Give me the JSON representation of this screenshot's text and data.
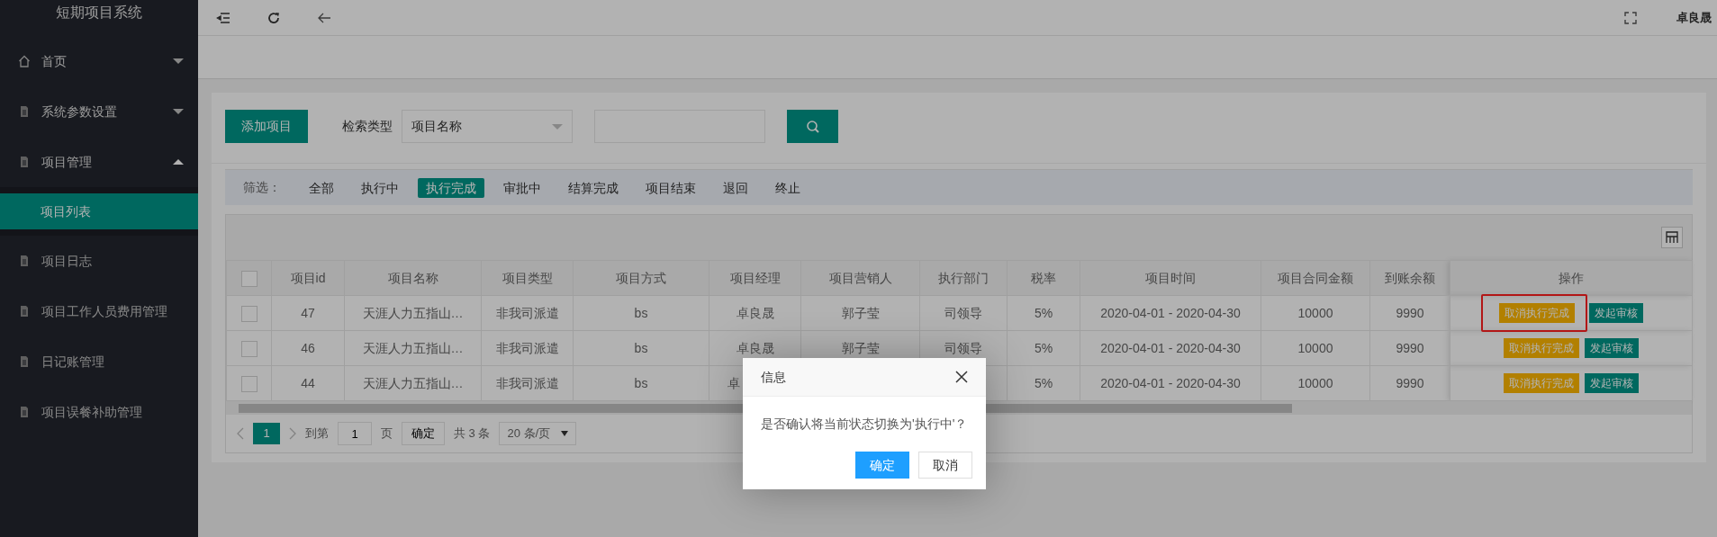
{
  "sidebar": {
    "title": "短期项目系统",
    "items": [
      {
        "label": "首页",
        "kind": "group",
        "expanded": false,
        "selected": false
      },
      {
        "label": "系统参数设置",
        "kind": "group",
        "expanded": false,
        "selected": false
      },
      {
        "label": "项目管理",
        "kind": "group",
        "expanded": true,
        "selected": false,
        "children": [
          {
            "label": "项目列表",
            "selected": true
          }
        ]
      },
      {
        "label": "项目日志",
        "kind": "link",
        "selected": false
      },
      {
        "label": "项目工作人员费用管理",
        "kind": "link",
        "selected": false
      },
      {
        "label": "日记账管理",
        "kind": "link",
        "selected": false
      },
      {
        "label": "项目误餐补助管理",
        "kind": "link",
        "selected": false
      }
    ]
  },
  "header": {
    "user": "卓良晟"
  },
  "toolbar": {
    "add_button": "添加项目",
    "search_type_label": "检索类型",
    "search_type": "项目名称"
  },
  "filter": {
    "label": "筛选：",
    "options": [
      {
        "label": "全部",
        "selected": false
      },
      {
        "label": "执行中",
        "selected": false
      },
      {
        "label": "执行完成",
        "selected": true
      },
      {
        "label": "审批中",
        "selected": false
      },
      {
        "label": "结算完成",
        "selected": false
      },
      {
        "label": "项目结束",
        "selected": false
      },
      {
        "label": "退回",
        "selected": false
      },
      {
        "label": "终止",
        "selected": false
      }
    ]
  },
  "table": {
    "all_checked": false,
    "columns": [
      "项目id",
      "项目名称",
      "项目类型",
      "项目方式",
      "项目经理",
      "项目营销人",
      "执行部门",
      "税率",
      "项目时间",
      "项目合同金额",
      "到账余额",
      "操作"
    ],
    "rows": [
      {
        "checked": false,
        "cells": [
          "47",
          "天涯人力五指山…",
          "非我司派遣",
          "bs",
          "卓良晟",
          "郭子莹",
          "司领导",
          "5%",
          "2020-04-01 - 2020-04-30",
          "10000",
          "9990"
        ],
        "actions": [
          {
            "label": "取消执行完成",
            "kind": "warning",
            "highlighted": true
          },
          {
            "label": "发起审核",
            "kind": "primary",
            "highlighted": false
          }
        ]
      },
      {
        "checked": false,
        "cells": [
          "46",
          "天涯人力五指山…",
          "非我司派遣",
          "bs",
          "卓良晟",
          "郭子莹",
          "司领导",
          "5%",
          "2020-04-01 - 2020-04-30",
          "10000",
          "9990"
        ],
        "actions": [
          {
            "label": "取消执行完成",
            "kind": "warning",
            "highlighted": false
          },
          {
            "label": "发起审核",
            "kind": "primary",
            "highlighted": false
          }
        ]
      },
      {
        "checked": false,
        "covered_by_dialog": true,
        "cells": [
          "44",
          "天涯人力五指山…",
          "非我司派遣",
          "bs",
          "卓",
          "",
          "",
          "5%",
          "2020-04-01 - 2020-04-30",
          "10000",
          "9990"
        ],
        "actions": [
          {
            "label": "取消执行完成",
            "kind": "warning",
            "highlighted": false
          },
          {
            "label": "发起审核",
            "kind": "primary",
            "highlighted": false
          }
        ]
      }
    ]
  },
  "pager": {
    "current": "1",
    "goto_label": "到第",
    "goto_value": "1",
    "page_unit": "页",
    "confirm": "确定",
    "total": "共 3 条",
    "page_size": "20 条/页"
  },
  "dialog": {
    "title": "信息",
    "message": "是否确认将当前状态切换为'执行中'？",
    "buttons": [
      {
        "label": "确定",
        "kind": "primary"
      },
      {
        "label": "取消",
        "kind": "secondary"
      }
    ]
  }
}
